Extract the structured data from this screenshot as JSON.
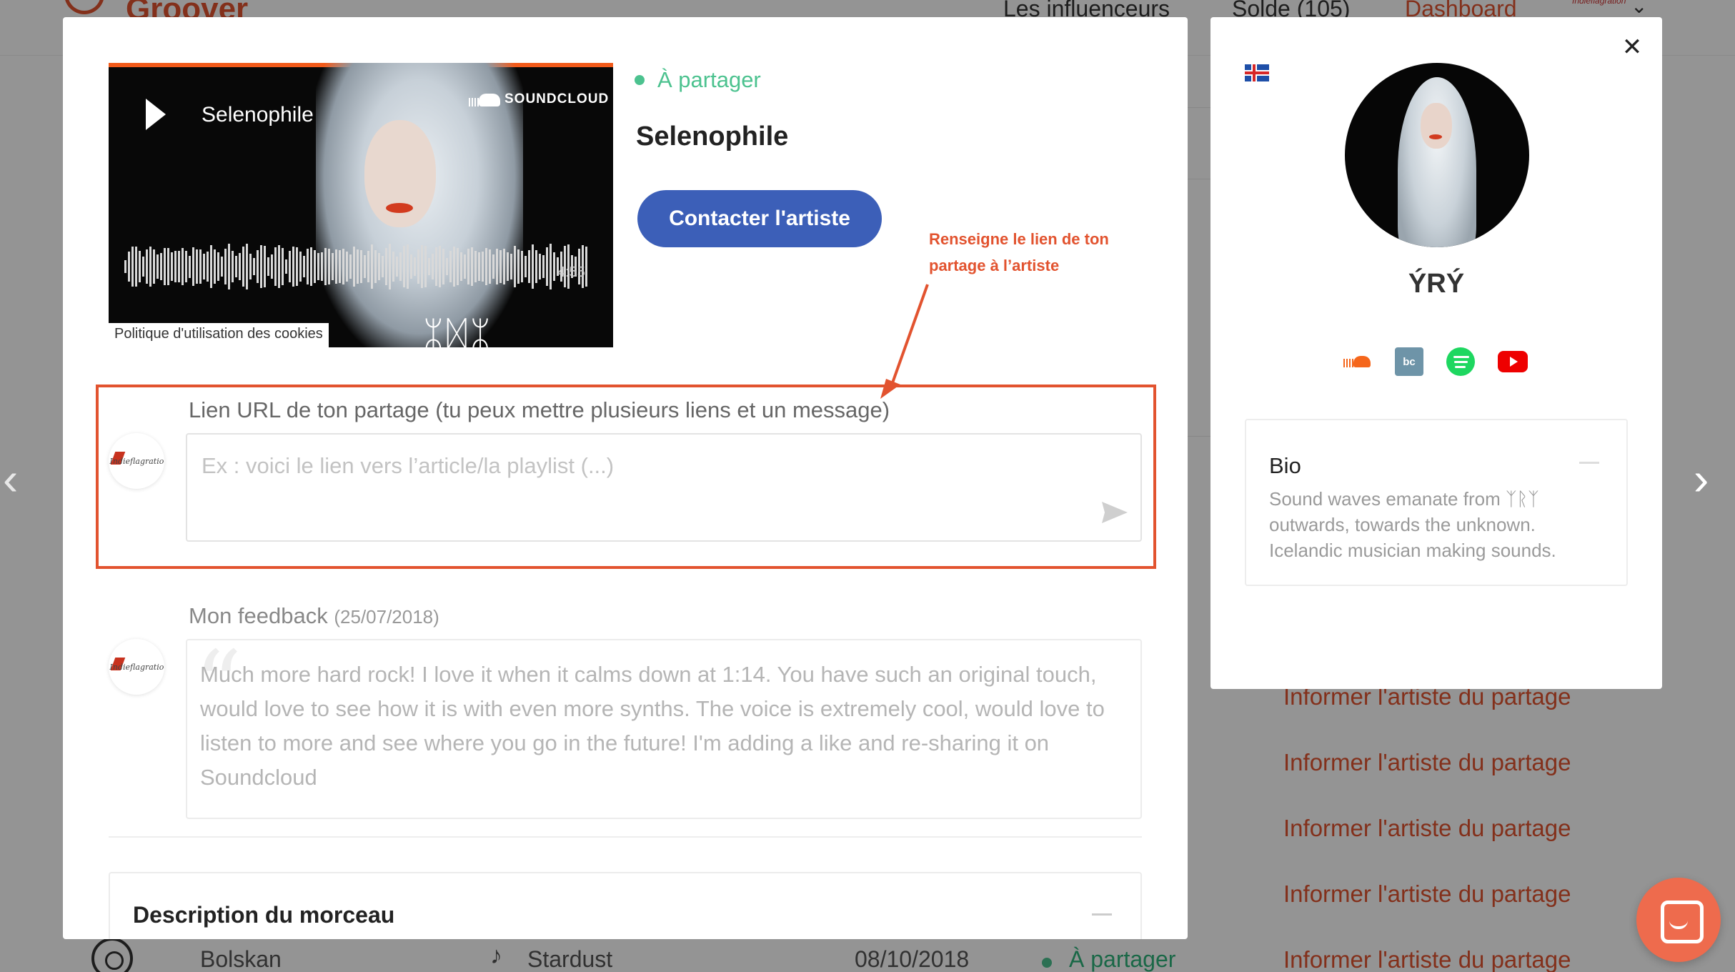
{
  "background": {
    "logo_text": "Groover",
    "nav": [
      "Les influenceurs",
      "Solde (105)",
      "Dashboard"
    ],
    "avatar_label": "Indieflagration",
    "row_link": "Informer l'artiste du partage",
    "bottom_row": {
      "artist": "Bolskan",
      "track": "Stardust",
      "date": "08/10/2018",
      "status": "À partager"
    }
  },
  "player": {
    "title": "Selenophile",
    "provider": "SOUNDCLOUD",
    "duration": "4:55",
    "cookie_notice": "Politique d'utilisation des cookies",
    "cover_runes": "ᛯᛞᛯ"
  },
  "track": {
    "status": "À partager",
    "title": "Selenophile",
    "contact_button": "Contacter l'artiste"
  },
  "annotation": {
    "line1": "Renseigne le lien de ton",
    "line2": "partage à l’artiste"
  },
  "share": {
    "label": "Lien URL de ton partage (tu peux mettre plusieurs liens et un message)",
    "placeholder": "Ex : voici le lien vers l’article/la playlist (...)",
    "value": ""
  },
  "feedback": {
    "label": "Mon feedback",
    "date": "(25/07/2018)",
    "text": "Much more hard rock! I love it when it calms down at 1:14. You have such an original touch, would love to see how it is with even more synths. The voice is extremely cool, would love to listen to more and see where you go in the future! I'm adding a like and re-sharing it on Soundcloud"
  },
  "description": {
    "title": "Description du morceau"
  },
  "artist": {
    "name": "ÝRÝ",
    "country_flag": "iceland-flag",
    "socials": [
      "soundcloud-icon",
      "bandcamp-icon",
      "spotify-icon",
      "youtube-icon"
    ],
    "bandcamp_glyph": "bc",
    "bio_title": "Bio",
    "bio_text": "Sound waves emanate from ᛉᚱᛉ outwards, towards the unknown. Icelandic musician making sounds."
  },
  "colors": {
    "accent": "#e2532f",
    "primary": "#3c5fb8",
    "status_green": "#4cc28f"
  }
}
